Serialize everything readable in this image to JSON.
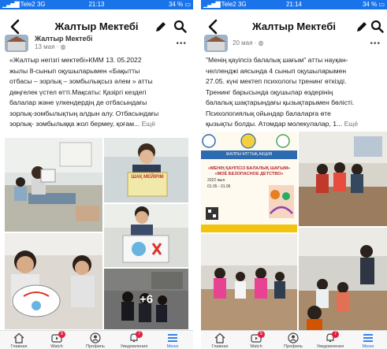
{
  "status_left": {
    "carrier": "Tele2",
    "network": "3G",
    "time": "21:13",
    "battery": "34 %"
  },
  "status_right": {
    "carrier": "Tele2",
    "network": "3G",
    "time": "21:14",
    "battery": "34 %"
  },
  "header": {
    "title": "Жалтыр Мектебі"
  },
  "left_post": {
    "page_name": "Жалтыр Мектебі",
    "meta": "13 мая ·",
    "lines": [
      "«Жалтыр негізгі мектебі»КММ 13. 05.2022",
      "жылы 8-сынып оқушыларымен «Бақытты",
      "отбасы – зорлық – зомбылықсыз әлем » атты",
      "дөңгелек үстел өтті.Мақсаты: Қазіргі кездегі",
      "балалар және үлкендердің де отбасындағы",
      "зорлық-зомбылықтың алдын алу. Отбасындағы"
    ],
    "last_line": "зорлық- зомбылыққа жол бермеу,   қоғам...",
    "more": " Ещё",
    "photo_sign": "ШАҚ МЕЙІРІМ",
    "more_photos": "+6"
  },
  "right_post": {
    "meta": "20 мая ·",
    "lines": [
      "\"Менің қауіпсіз балалық шағым\" атты науқан-",
      "челленджі аясында 4 сынып оқушыларымен",
      "27.05. күні мектеп психологы тренинг өткізді.",
      "Тренинг барысында оқушылар өздерінің",
      "балалық шақтарындағы қызықтарымен бөлісті.",
      "Психологиялық ойындар балаларға өте"
    ],
    "last_line": "қызықты болды. Атомдар молекулалар, 1...",
    "more": " Ещё",
    "flyer": {
      "band": "ЖАЛПЫ ҰЛТТЫҚ АКЦИЯ",
      "title": "«МЕНІҢ ҚАУІПСІЗ БАЛАЛЫҚ ШАҒЫМ» «МОЁ БЕЗОПАСНОЕ ДЕТСТВО»",
      "date": "2022 жыл",
      "dates_range": "01.05 - 01.06"
    }
  },
  "bottom_nav": [
    {
      "label": "Главная",
      "icon": "home-icon",
      "badge": ""
    },
    {
      "label": "Watch",
      "icon": "video-icon",
      "badge": "5"
    },
    {
      "label": "Профиль",
      "icon": "profile-icon",
      "badge": ""
    },
    {
      "label": "Уведомления",
      "icon": "bell-icon",
      "badge": "7"
    },
    {
      "label": "Меню",
      "icon": "menu-icon",
      "badge": ""
    }
  ],
  "colors": {
    "accent": "#1a73e8",
    "badge": "#e41e3f",
    "status_bar": "#1a73e8"
  }
}
